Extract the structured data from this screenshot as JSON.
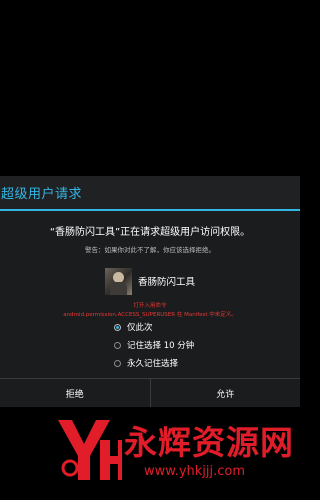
{
  "dialog": {
    "title": "超级用户请求",
    "prompt": "“香肠防闪工具”正在请求超级用户访问权限。",
    "warning": "警告：如果你对此不了解，你应该选择拒绝。",
    "app_name": "香肠防闪工具",
    "red_line1": "打开入用命令",
    "red_line2": "android.permission.ACCESS_SUPERUSER 在 Manifest 中未定义。",
    "options": [
      {
        "label": "仅此次",
        "selected": true
      },
      {
        "label": "记住选择 10 分钟",
        "selected": false
      },
      {
        "label": "永久记住选择",
        "selected": false
      }
    ],
    "deny_label": "拒绝",
    "allow_label": "允许"
  },
  "watermark": {
    "text": "永辉资源网",
    "url": "www.yhkjjj.com"
  },
  "colors": {
    "accent": "#33b5e5",
    "background": "#000000",
    "dialog": "#1b1c1e",
    "warning_text": "#e53935",
    "watermark": "#e11d2a"
  }
}
